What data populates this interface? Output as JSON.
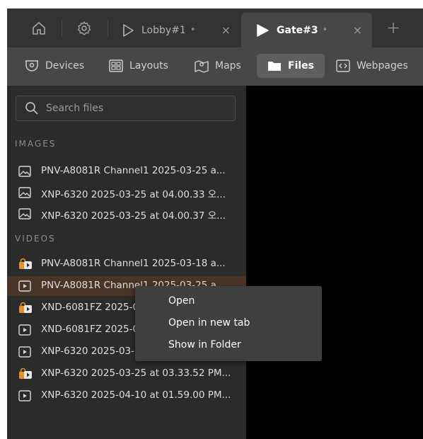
{
  "tabbar": {
    "icons": [
      "home-icon",
      "gear-icon"
    ],
    "tabs": [
      {
        "title": "Lobby#1",
        "dot": "•",
        "close": "×",
        "active": false
      },
      {
        "title": "Gate#3",
        "dot": "•",
        "close": "×",
        "active": true
      }
    ],
    "add_label": "+"
  },
  "toolbar": {
    "items": [
      {
        "label": "Devices",
        "icon": "camera-icon"
      },
      {
        "label": "Layouts",
        "icon": "layout-grid-icon"
      },
      {
        "label": "Maps",
        "icon": "map-icon"
      },
      {
        "label": "Files",
        "icon": "folder-icon",
        "active": true
      },
      {
        "label": "Webpages",
        "icon": "code-icon"
      }
    ]
  },
  "sidebar": {
    "search_placeholder": "Search files",
    "images_header": "IMAGES",
    "videos_header": "VIDEOS",
    "images": [
      "PNV-A8081R Channel1 2025-03-25 a...",
      "XNP-6320 2025-03-25 at 04.00.33 오...",
      "XNP-6320 2025-03-25 at 04.00.37 오..."
    ],
    "videos": [
      {
        "name": "PNV-A8081R Channel1 2025-03-18 a...",
        "locked": true
      },
      {
        "name": "PNV-A8081R Channel1 2025-03-25 a...",
        "locked": false,
        "selected": true
      },
      {
        "name": "XND-6081FZ 2025-0",
        "locked": true
      },
      {
        "name": "XND-6081FZ 2025-0",
        "locked": false
      },
      {
        "name": "XNP-6320 2025-03-",
        "locked": false
      },
      {
        "name": "XNP-6320 2025-03-25 at 03.33.52 PM...",
        "locked": true
      },
      {
        "name": "XNP-6320 2025-04-10 at 01.59.00 PM...",
        "locked": false
      }
    ]
  },
  "context_menu": {
    "items": [
      "Open",
      "Open in new tab",
      "Show in Folder"
    ]
  },
  "colors": {
    "accent_lock": "#e0922e",
    "selected_row": "#4a3426",
    "panel": "#2b2b2b",
    "toolbar": "#474747"
  }
}
